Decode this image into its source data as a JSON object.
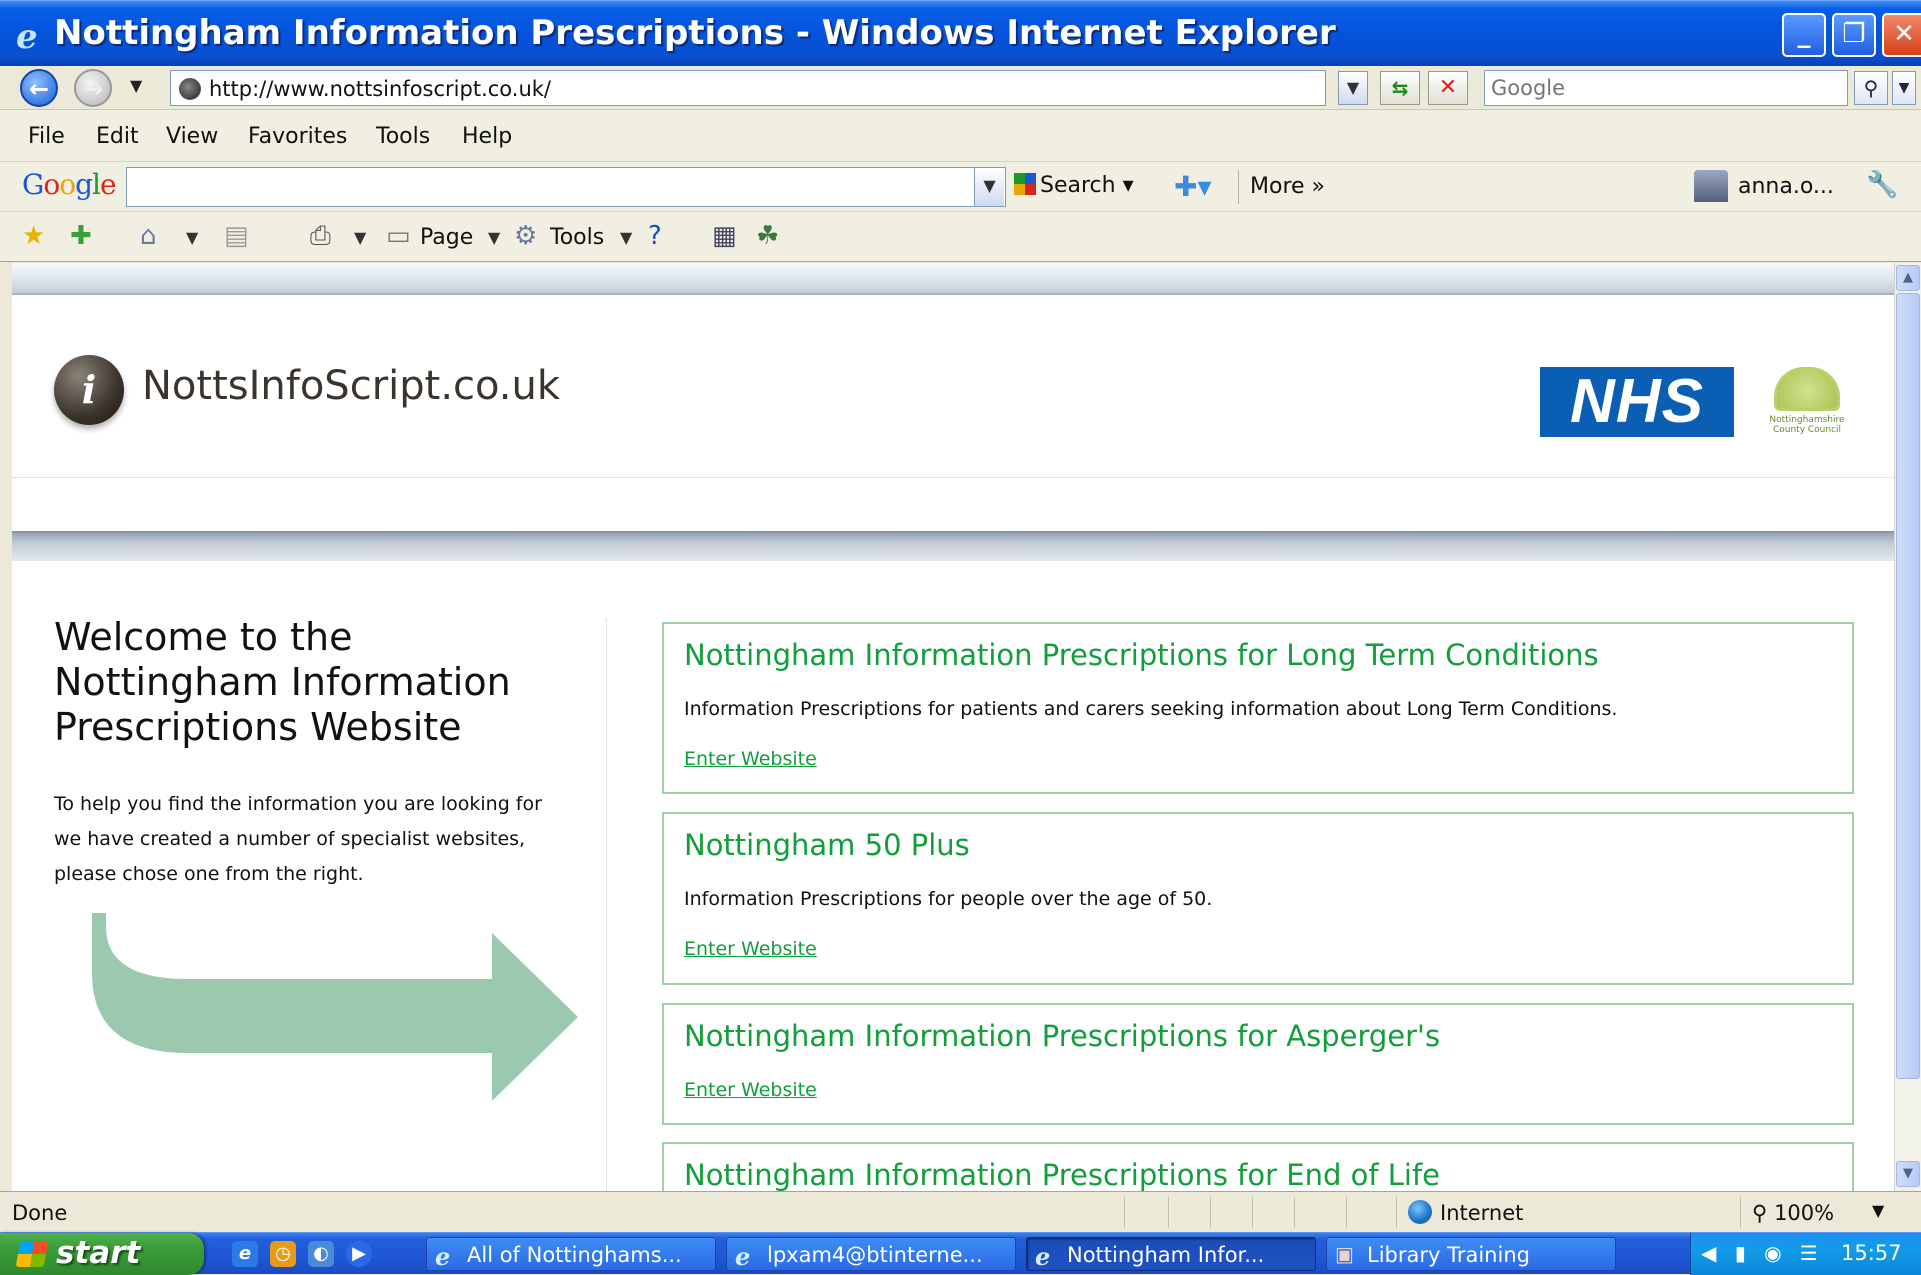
{
  "window": {
    "title": "Nottingham Information Prescriptions - Windows Internet Explorer"
  },
  "address_bar": {
    "url": "http://www.nottsinfoscript.co.uk/",
    "search_placeholder": "Google"
  },
  "menu": [
    "File",
    "Edit",
    "View",
    "Favorites",
    "Tools",
    "Help"
  ],
  "google_toolbar": {
    "logo": "Google",
    "search_label": "Search",
    "more_label": "More »",
    "user": "anna.o..."
  },
  "command_bar": {
    "page_label": "Page",
    "tools_label": "Tools"
  },
  "site": {
    "name": "NottsInfoScript.co.uk",
    "nhs_logo": "NHS",
    "council_logo": "Nottinghamshire County Council",
    "welcome": "Welcome to the Nottingham Information Prescriptions Website",
    "intro_lines": [
      "To help you find the information you are looking for",
      "we have created a number of specialist websites,",
      "please chose one from the right."
    ],
    "panels": [
      {
        "title": "Nottingham Information Prescriptions for Long Term Conditions",
        "desc": "Information Prescriptions for patients and carers seeking information about Long Term Conditions.",
        "link": "Enter Website"
      },
      {
        "title": "Nottingham 50 Plus",
        "desc": "Information Prescriptions for people over the age of 50.",
        "link": "Enter Website"
      },
      {
        "title": "Nottingham Information Prescriptions for Asperger's",
        "desc": "",
        "link": "Enter Website"
      },
      {
        "title": "Nottingham Information Prescriptions for End of Life",
        "desc": "",
        "link": ""
      }
    ]
  },
  "status_bar": {
    "status": "Done",
    "zone": "Internet",
    "zoom": "100%"
  },
  "taskbar": {
    "start_label": "start",
    "tasks": [
      "All of Nottinghams...",
      "lpxam4@btinterne...",
      "Nottingham Infor...",
      "Library Training"
    ],
    "clock": "15:57"
  },
  "colors": {
    "accent_green": "#129e3a",
    "panel_border": "#9fd0a7",
    "nhs_blue": "#0a5fb4",
    "arrow_fill": "#9bc9b0"
  }
}
